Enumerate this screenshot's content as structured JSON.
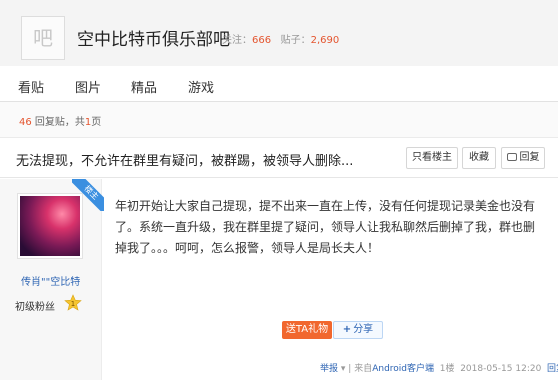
{
  "header": {
    "logo_char": "吧",
    "forum_name": "空中比特币俱乐部吧",
    "follow_label": "关注：",
    "follow_count": "666",
    "posts_label": "贴子：",
    "posts_count": "2,690"
  },
  "nav": {
    "items": [
      {
        "label": "看贴"
      },
      {
        "label": "图片"
      },
      {
        "label": "精品"
      },
      {
        "label": "游戏"
      }
    ]
  },
  "pager": {
    "reply_count": "46",
    "reply_label": "回复贴，共",
    "page_count": "1",
    "page_label": "页"
  },
  "thread": {
    "title": "无法提现，不允许在群里有疑问，被群踢，被领导人删除...",
    "only_op_label": "只看楼主",
    "collect_label": "收藏",
    "reply_label": "回复"
  },
  "post": {
    "ribbon_label": "楼主",
    "username": "传肖\"\"空比特",
    "badge_name": "初级粉丝",
    "badge_level": "1",
    "body": "年初开始让大家自己提现，提不出来一直在上传，没有任何提现记录美金也没有了。系统一直升级，我在群里提了疑问，领导人让我私聊然后删掉了我，群也删掉我了。。。呵呵，怎么报警，领导人是局长夫人！",
    "gift_label": "送TA礼物",
    "share_label": "分享",
    "report_label": "举报",
    "from_label": "| 来自",
    "client_label": "Android客户端",
    "floor_label": "1楼",
    "timestamp": "2018-05-15 12:20",
    "reply_link_label": "回复"
  },
  "colors": {
    "accent_orange": "#e4552f",
    "link_blue": "#2d64b3",
    "gift_orange": "#f1672e",
    "ribbon_blue": "#3b8fe0"
  }
}
